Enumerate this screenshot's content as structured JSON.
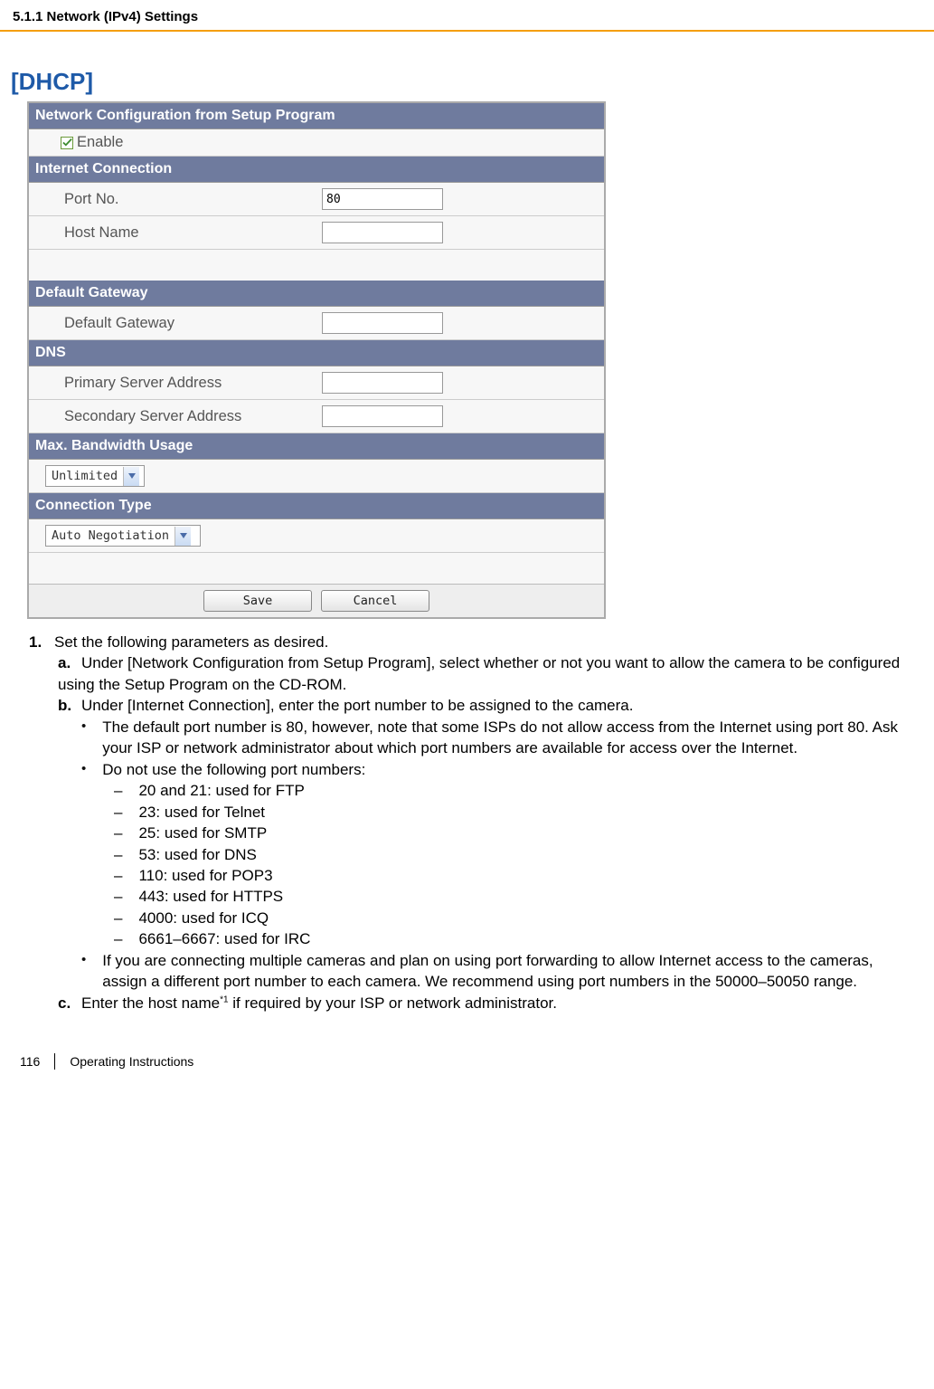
{
  "header": {
    "section": "5.1.1 Network (IPv4) Settings"
  },
  "title": "[DHCP]",
  "panel": {
    "sections": {
      "netConfig": {
        "header": "Network Configuration from Setup Program",
        "enable_label": "Enable",
        "checked": true
      },
      "internet": {
        "header": "Internet Connection",
        "port_label": "Port No.",
        "port_value": "80",
        "host_label": "Host Name",
        "host_value": ""
      },
      "gateway": {
        "header": "Default Gateway",
        "gw_label": "Default Gateway",
        "gw_value": ""
      },
      "dns": {
        "header": "DNS",
        "primary_label": "Primary Server Address",
        "primary_value": "",
        "secondary_label": "Secondary Server Address",
        "secondary_value": ""
      },
      "bandwidth": {
        "header": "Max. Bandwidth Usage",
        "value": "Unlimited"
      },
      "conn": {
        "header": "Connection Type",
        "value": "Auto Negotiation"
      }
    },
    "buttons": {
      "save": "Save",
      "cancel": "Cancel"
    }
  },
  "instructions": {
    "item1": "Set the following parameters as desired.",
    "a": "Under [Network Configuration from Setup Program], select whether or not you want to allow the camera to be configured using the Setup Program on the CD-ROM.",
    "b": "Under [Internet Connection], enter the port number to be assigned to the camera.",
    "b_b1": "The default port number is 80, however, note that some ISPs do not allow access from the Internet using port 80. Ask your ISP or network administrator about which port numbers are available for access over the Internet.",
    "b_b2": "Do not use the following port numbers:",
    "ports": [
      "20 and 21: used for FTP",
      "23: used for Telnet",
      "25: used for SMTP",
      "53: used for DNS",
      "110: used for POP3",
      "443: used for HTTPS",
      "4000: used for ICQ",
      "6661–6667: used for IRC"
    ],
    "b_b3": "If you are connecting multiple cameras and plan on using port forwarding to allow Internet access to the cameras, assign a different port number to each camera. We recommend using port numbers in the 50000–50050 range.",
    "c_pre": "Enter the host name",
    "c_sup": "*1",
    "c_post": " if required by your ISP or network administrator."
  },
  "footer": {
    "page": "116",
    "doc": "Operating Instructions"
  }
}
